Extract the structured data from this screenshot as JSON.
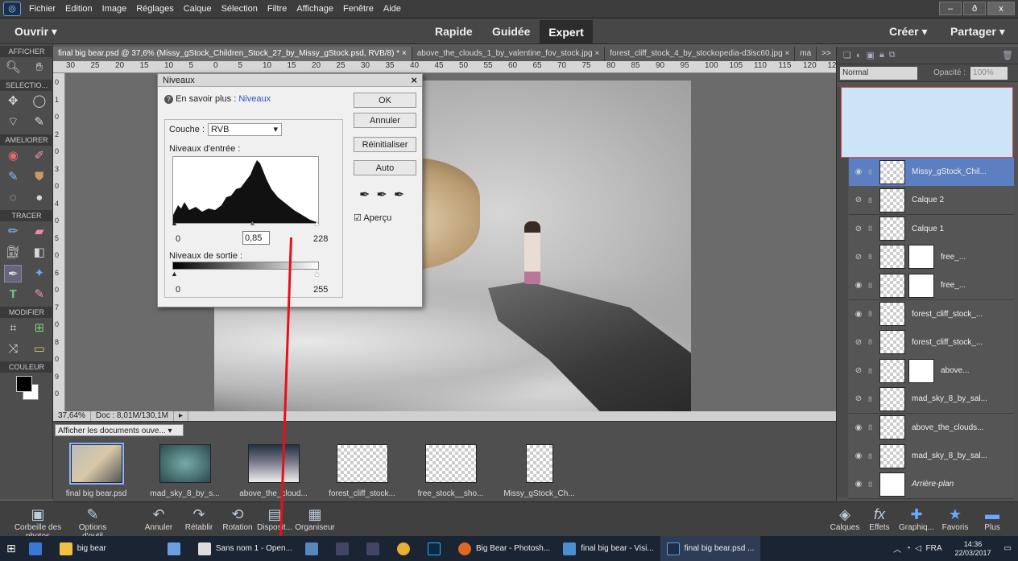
{
  "menubar": {
    "items": [
      "Fichier",
      "Edition",
      "Image",
      "Réglages",
      "Calque",
      "Sélection",
      "Filtre",
      "Affichage",
      "Fenêtre",
      "Aide"
    ]
  },
  "window_controls": {
    "minimize": "–",
    "maximize": "ð",
    "close": "x"
  },
  "modebar": {
    "open": "Ouvrir",
    "modes": [
      "Rapide",
      "Guidée",
      "Expert"
    ],
    "create": "Créer",
    "share": "Partager"
  },
  "toolbox": {
    "afficher": "AFFICHER",
    "selection": "SELECTIO...",
    "ameliorer": "AMELIORER",
    "tracer": "TRACER",
    "modifier": "MODIFIER",
    "couleur": "COULEUR"
  },
  "doctabs": [
    "final big bear.psd @ 37,6% (Missy_gStock_Children_Stock_27_by_Missy_gStock.psd, RVB/8) *",
    "×",
    "above_the_clouds_1_by_valentine_fov_stock.jpg",
    "×",
    "forest_cliff_stock_4_by_stockopedia-d3isc60.jpg",
    "×",
    "ma",
    ">>"
  ],
  "ruler_h": [
    "30",
    "25",
    "20",
    "15",
    "10",
    "5",
    "0",
    "5",
    "10",
    "15",
    "20",
    "25",
    "30",
    "35",
    "40",
    "45",
    "50",
    "55",
    "60",
    "65",
    "70",
    "75",
    "80",
    "85",
    "90",
    "95",
    "100",
    "105",
    "110",
    "115",
    "120",
    "125"
  ],
  "ruler_v": [
    "0",
    "1",
    "0",
    "2",
    "0",
    "3",
    "0",
    "4",
    "0",
    "5",
    "0",
    "6",
    "0",
    "7",
    "0",
    "8",
    "0",
    "9",
    "0"
  ],
  "status": {
    "zoom": "37,64%",
    "doc": "Doc : 8,01M/130,1M"
  },
  "photobin": {
    "select": "Afficher les documents ouve...",
    "thumbs": [
      "final big bear.psd",
      "mad_sky_8_by_s...",
      "above_the_cloud...",
      "forest_cliff_stock...",
      "free_stock__sho...",
      "Missy_gStock_Ch..."
    ]
  },
  "app_buttons": [
    "Corbeille des photos",
    "Options d'outil",
    "Annuler",
    "Rétablir",
    "Rotation",
    "Disposit...",
    "Organiseur"
  ],
  "right_buttons": [
    "Calques",
    "Effets",
    "Graphiq...",
    "Favoris",
    "Plus"
  ],
  "layers_panel": {
    "blend_mode": "Normal",
    "opacity_label": "Opacité :",
    "opacity_value": "100%",
    "layers": [
      {
        "name": "Missy_gStock_Chil..."
      },
      {
        "name": "Calque 2"
      },
      {
        "name": "Calque 1"
      },
      {
        "name": "free_..."
      },
      {
        "name": "free_..."
      },
      {
        "name": "forest_cliff_stock_..."
      },
      {
        "name": "forest_cliff_stock_..."
      },
      {
        "name": "above..."
      },
      {
        "name": "mad_sky_8_by_sal..."
      },
      {
        "name": "above_the_clouds..."
      },
      {
        "name": "mad_sky_8_by_sal..."
      },
      {
        "name": "Arrière-plan"
      }
    ]
  },
  "dialog": {
    "title": "Niveaux",
    "help_prefix": "En savoir plus : ",
    "help_link": "Niveaux",
    "channel_label": "Couche :",
    "channel_value": "RVB",
    "input_label": "Niveaux d'entrée :",
    "input_black": "0",
    "input_gamma": "0,85",
    "input_white": "228",
    "output_label": "Niveaux de sortie :",
    "output_black": "0",
    "output_white": "255",
    "buttons": {
      "ok": "OK",
      "cancel": "Annuler",
      "reset": "Réinitialiser",
      "auto": "Auto"
    },
    "preview": "Aperçu"
  },
  "win_taskbar": {
    "items": [
      "big bear",
      "Sans nom 1 - Open...",
      "Big Bear - Photosh...",
      "final big bear - Visi...",
      "final big bear.psd ..."
    ],
    "lang": "FRA",
    "time": "14:36",
    "date": "22/03/2017"
  },
  "colors": {
    "accent": "#5b7fc0",
    "annotation": "#e8101a"
  }
}
